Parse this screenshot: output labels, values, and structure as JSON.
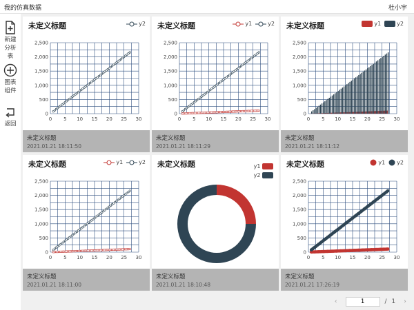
{
  "app": {
    "title": "我的仿真数据",
    "user": "杜小宇"
  },
  "sidebar": {
    "items": [
      {
        "label": "新建分析表",
        "icon": "new-file-icon"
      },
      {
        "label": "图表组件",
        "icon": "add-circle-icon"
      },
      {
        "label": "返回",
        "icon": "return-icon"
      }
    ]
  },
  "colors": {
    "y1": "#c23531",
    "y2": "#2f4554",
    "grid": "#2f4f7f"
  },
  "pagination": {
    "prev": "‹",
    "next": "›",
    "current": "1",
    "separator": "/",
    "total": "1"
  },
  "cards": [
    {
      "title": "未定义标题",
      "footer_title": "未定义标题",
      "timestamp": "2021.01.21 18:11:50",
      "chart_data": {
        "type": "line",
        "marker": "hollow-circle",
        "series": [
          {
            "name": "y2",
            "key": "y2"
          }
        ],
        "xlim": [
          0,
          30
        ],
        "ylim": [
          0,
          2500
        ],
        "xticks": [
          0,
          5,
          10,
          15,
          20,
          25,
          30
        ],
        "yticks": [
          0,
          500,
          1000,
          1500,
          2000,
          2500
        ],
        "x": [
          1,
          27
        ],
        "y2_slope": 80,
        "y1_slope": 4
      }
    },
    {
      "title": "未定义标题",
      "footer_title": "未定义标题",
      "timestamp": "2021.01.21 18:11:29",
      "chart_data": {
        "type": "line",
        "marker": "hollow-circle",
        "series": [
          {
            "name": "y1",
            "key": "y1"
          },
          {
            "name": "y2",
            "key": "y2"
          }
        ],
        "xlim": [
          0,
          30
        ],
        "ylim": [
          0,
          2500
        ],
        "xticks": [
          0,
          5,
          10,
          15,
          20,
          25,
          30
        ],
        "yticks": [
          0,
          500,
          1000,
          1500,
          2000,
          2500
        ],
        "x": [
          1,
          27
        ],
        "y2_slope": 80,
        "y1_slope": 4
      }
    },
    {
      "title": "未定义标题",
      "footer_title": "未定义标题",
      "timestamp": "2021.01.21 18:11:12",
      "chart_data": {
        "type": "bar",
        "series": [
          {
            "name": "y1",
            "key": "y1"
          },
          {
            "name": "y2",
            "key": "y2"
          }
        ],
        "xlim": [
          0,
          30
        ],
        "ylim": [
          0,
          2500
        ],
        "xticks": [
          0,
          5,
          10,
          15,
          20,
          25,
          30
        ],
        "yticks": [
          0,
          500,
          1000,
          1500,
          2000,
          2500
        ],
        "x": [
          1,
          27
        ],
        "y2_slope": 80,
        "y1_slope": 4
      }
    },
    {
      "title": "未定义标题",
      "footer_title": "未定义标题",
      "timestamp": "2021.01.21 18:11:00",
      "chart_data": {
        "type": "line",
        "marker": "hollow-circle",
        "series": [
          {
            "name": "y1",
            "key": "y1"
          },
          {
            "name": "y2",
            "key": "y2"
          }
        ],
        "xlim": [
          0,
          30
        ],
        "ylim": [
          0,
          2500
        ],
        "xticks": [
          0,
          5,
          10,
          15,
          20,
          25,
          30
        ],
        "yticks": [
          0,
          500,
          1000,
          1500,
          2000,
          2500
        ],
        "x": [
          1,
          27
        ],
        "y2_slope": 80,
        "y1_slope": 4
      }
    },
    {
      "title": "未定义标题",
      "footer_title": "未定义标题",
      "timestamp": "2021.01.21 18:10:48",
      "chart_data": {
        "type": "pie",
        "donut": true,
        "series": [
          {
            "name": "y1",
            "key": "y1",
            "value": 25
          },
          {
            "name": "y2",
            "key": "y2",
            "value": 75
          }
        ]
      }
    },
    {
      "title": "未定义标题",
      "footer_title": "未定义标题",
      "timestamp": "2021.01.21 17:26:19",
      "chart_data": {
        "type": "scatter",
        "marker": "filled-circle",
        "series": [
          {
            "name": "y1",
            "key": "y1"
          },
          {
            "name": "y2",
            "key": "y2"
          }
        ],
        "xlim": [
          0,
          30
        ],
        "ylim": [
          0,
          2500
        ],
        "xticks": [
          0,
          5,
          10,
          15,
          20,
          25,
          30
        ],
        "yticks": [
          0,
          500,
          1000,
          1500,
          2000,
          2500
        ],
        "x": [
          1,
          27
        ],
        "y2_slope": 80,
        "y1_slope": 4
      }
    }
  ]
}
